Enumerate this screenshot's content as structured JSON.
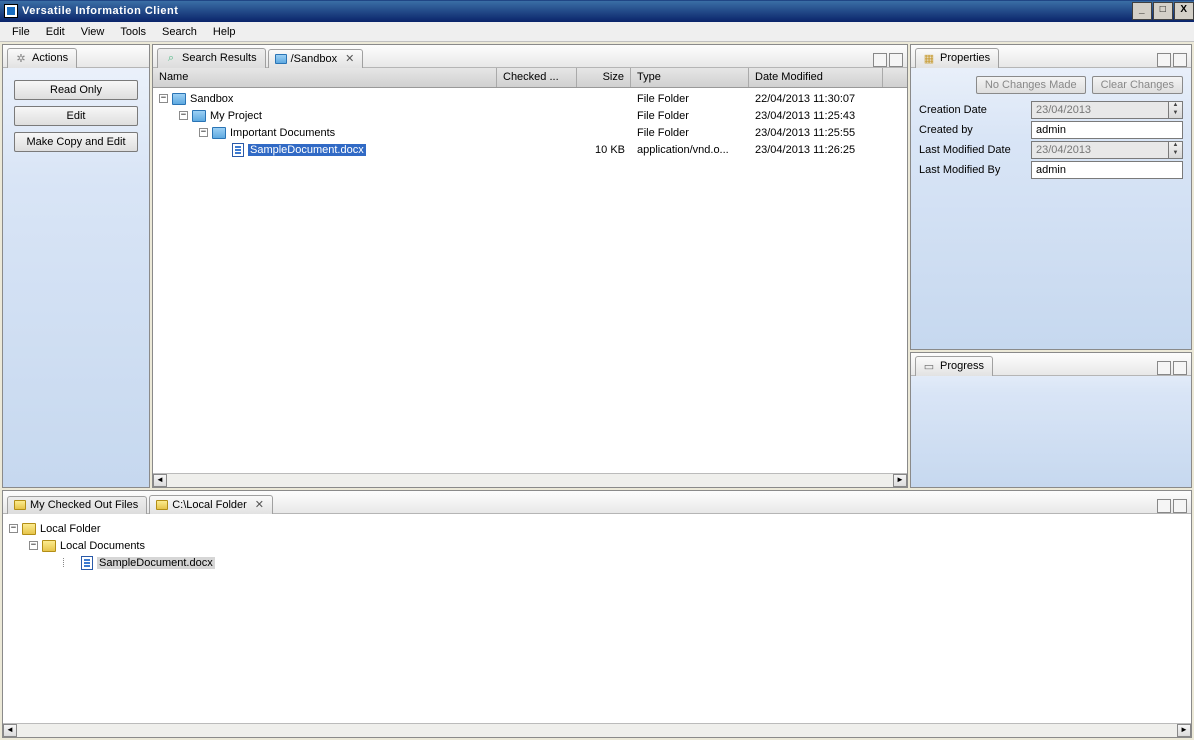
{
  "window": {
    "title": "Versatile Information Client"
  },
  "menubar": {
    "file": "File",
    "edit": "Edit",
    "view": "View",
    "tools": "Tools",
    "search": "Search",
    "help": "Help"
  },
  "actions": {
    "tab": "Actions",
    "read_only": "Read Only",
    "edit": "Edit",
    "make_copy": "Make Copy and Edit"
  },
  "searchTab": "Search Results",
  "sandboxTab": "/Sandbox",
  "columns": {
    "name": "Name",
    "checked": "Checked ...",
    "size": "Size",
    "type": "Type",
    "date": "Date Modified"
  },
  "tree": {
    "r0": {
      "name": "Sandbox",
      "type": "File Folder",
      "date": "22/04/2013 11:30:07"
    },
    "r1": {
      "name": "My Project",
      "type": "File Folder",
      "date": "23/04/2013 11:25:43"
    },
    "r2": {
      "name": "Important Documents",
      "type": "File Folder",
      "date": "23/04/2013 11:25:55"
    },
    "r3": {
      "name": "SampleDocument.docx",
      "size": "10 KB",
      "type": "application/vnd.o...",
      "date": "23/04/2013 11:26:25"
    }
  },
  "checkedTab": "My Checked Out Files",
  "localTab": "C:\\Local Folder",
  "local": {
    "root": "Local Folder",
    "sub": "Local Documents",
    "file": "SampleDocument.docx"
  },
  "properties": {
    "tab": "Properties",
    "noChanges": "No Changes Made",
    "clear": "Clear Changes",
    "creationDate_label": "Creation Date",
    "creationDate_val": "23/04/2013",
    "createdBy_label": "Created by",
    "createdBy_val": "admin",
    "lastModDate_label": "Last Modified Date",
    "lastModDate_val": "23/04/2013",
    "lastModBy_label": "Last Modified By",
    "lastModBy_val": "admin"
  },
  "progress": {
    "tab": "Progress"
  }
}
